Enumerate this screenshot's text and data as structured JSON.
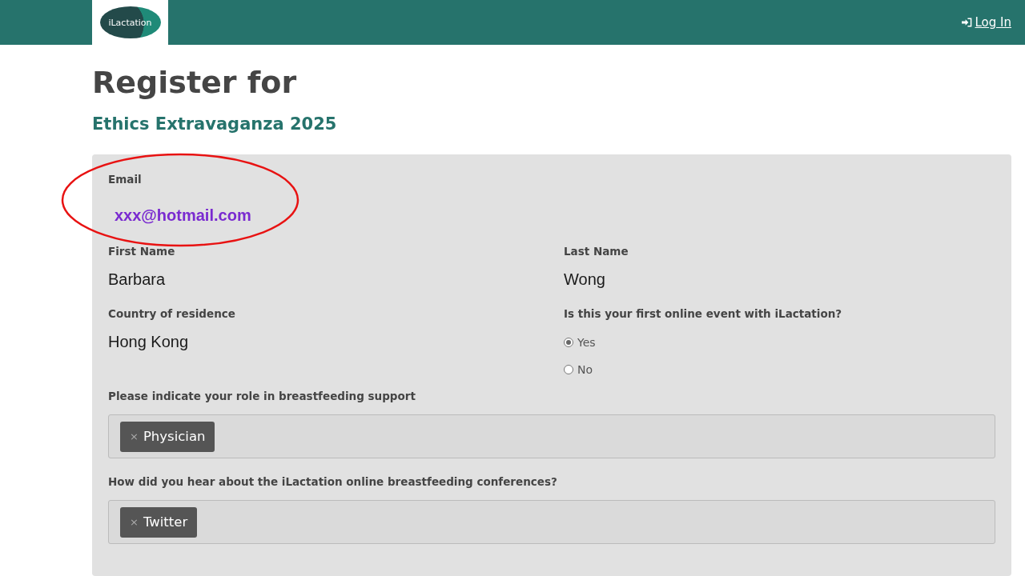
{
  "header": {
    "logo": "iLactation",
    "login": "Log In"
  },
  "title": "Register for",
  "event": "Ethics Extravaganza 2025",
  "form": {
    "email": {
      "label": "Email",
      "value": "xxx@hotmail.com",
      "highlighted": true
    },
    "first_name": {
      "label": "First Name",
      "value": "Barbara"
    },
    "last_name": {
      "label": "Last Name",
      "value": "Wong"
    },
    "country": {
      "label": "Country of residence",
      "value": "Hong Kong"
    },
    "first_event": {
      "label": "Is this your first online event with iLactation?",
      "options": [
        {
          "label": "Yes",
          "selected": true
        },
        {
          "label": "No",
          "selected": false
        }
      ]
    },
    "role": {
      "label": "Please indicate your role in breastfeeding support",
      "tags": [
        {
          "remove": "×",
          "label": "Physician"
        }
      ]
    },
    "heard": {
      "label": "How did you hear about the iLactation online breastfeeding conferences?",
      "tags": [
        {
          "remove": "×",
          "label": "Twitter"
        }
      ]
    }
  }
}
